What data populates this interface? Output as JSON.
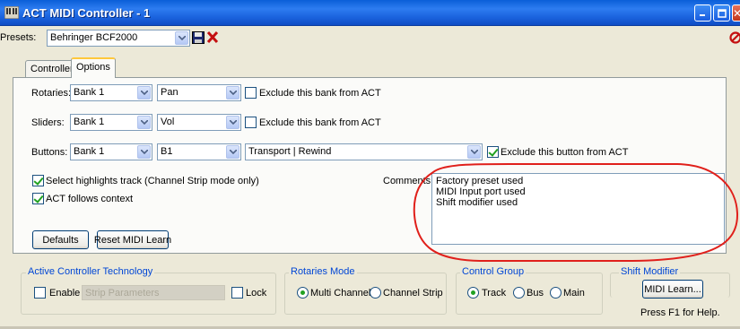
{
  "window": {
    "title": "ACT MIDI Controller - 1"
  },
  "presets": {
    "label": "Presets:",
    "value": "Behringer BCF2000"
  },
  "tabs": [
    {
      "label": "Controllers",
      "active": false
    },
    {
      "label": "Options",
      "active": true
    }
  ],
  "options": {
    "rotaries": {
      "label": "Rotaries:",
      "bank": "Bank 1",
      "param": "Pan",
      "exclude_label": "Exclude this bank from ACT",
      "exclude_checked": false
    },
    "sliders": {
      "label": "Sliders:",
      "bank": "Bank 1",
      "param": "Vol",
      "exclude_label": "Exclude this bank from ACT",
      "exclude_checked": false
    },
    "buttons": {
      "label": "Buttons:",
      "bank": "Bank 1",
      "button": "B1",
      "action": "Transport | Rewind",
      "exclude_label": "Exclude this button from ACT",
      "exclude_checked": true
    },
    "select_highlights": {
      "label": "Select highlights track (Channel Strip mode only)",
      "checked": true
    },
    "act_follows": {
      "label": "ACT follows context",
      "checked": true
    },
    "defaults_button": "Defaults",
    "reset_button": "Reset MIDI Learn",
    "comments_label": "Comments:",
    "comments_lines": [
      "Factory preset used",
      "MIDI Input port used",
      "Shift modifier used"
    ]
  },
  "act_group": {
    "title": "Active Controller Technology",
    "enable_label": "Enable",
    "enable_checked": false,
    "strip_field": "Strip Parameters",
    "lock_label": "Lock",
    "lock_checked": false
  },
  "rotaries_mode": {
    "title": "Rotaries Mode",
    "options": [
      "Multi Channel",
      "Channel Strip"
    ],
    "selected": "Multi Channel"
  },
  "control_group": {
    "title": "Control Group",
    "options": [
      "Track",
      "Bus",
      "Main"
    ],
    "selected": "Track"
  },
  "shift_modifier": {
    "title": "Shift Modifier",
    "button": "MIDI Learn..."
  },
  "status": {
    "help": "Press F1 for Help."
  },
  "colors": {
    "highlight_ellipse": "#e0201b",
    "titlebar": "#0a5fd8",
    "group_title": "#0046d5"
  }
}
